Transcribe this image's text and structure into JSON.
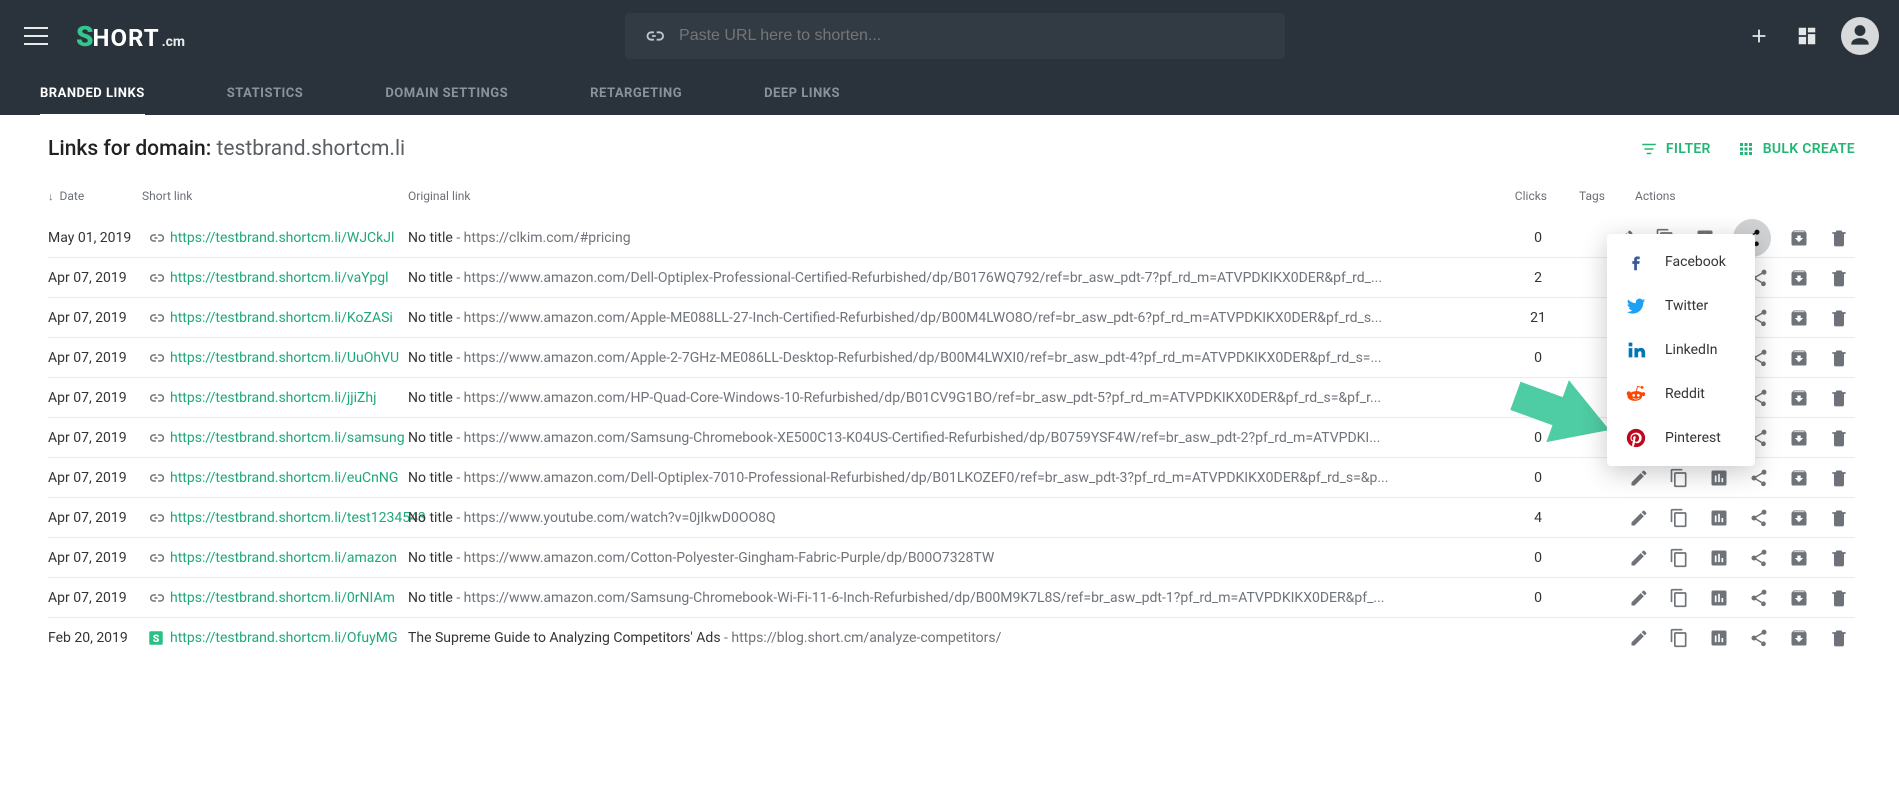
{
  "header": {
    "search_placeholder": "Paste URL here to shorten..."
  },
  "nav": [
    "BRANDED LINKS",
    "STATISTICS",
    "DOMAIN SETTINGS",
    "RETARGETING",
    "DEEP LINKS"
  ],
  "page": {
    "title_prefix": "Links for domain: ",
    "domain": "testbrand.shortcm.li",
    "filter_label": "FILTER",
    "bulk_label": "BULK CREATE"
  },
  "columns": {
    "date": "Date",
    "short": "Short link",
    "orig": "Original link",
    "clicks": "Clicks",
    "tags": "Tags",
    "actions": "Actions"
  },
  "share_menu": [
    "Facebook",
    "Twitter",
    "LinkedIn",
    "Reddit",
    "Pinterest"
  ],
  "rows": [
    {
      "date": "May 01, 2019",
      "short": "https://testbrand.shortcm.li/WJCkJl",
      "title": "No title",
      "orig": "https://clkim.com/#pricing",
      "clicks": "0"
    },
    {
      "date": "Apr 07, 2019",
      "short": "https://testbrand.shortcm.li/vaYpgl",
      "title": "No title",
      "orig": "https://www.amazon.com/Dell-Optiplex-Professional-Certified-Refurbished/dp/B0176WQ792/ref=br_asw_pdt-7?pf_rd_m=ATVPDKIKX0DER&pf_rd_...",
      "clicks": "2"
    },
    {
      "date": "Apr 07, 2019",
      "short": "https://testbrand.shortcm.li/KoZASi",
      "title": "No title",
      "orig": "https://www.amazon.com/Apple-ME088LL-27-Inch-Certified-Refurbished/dp/B00M4LWO8O/ref=br_asw_pdt-6?pf_rd_m=ATVPDKIKX0DER&pf_rd_s...",
      "clicks": "21"
    },
    {
      "date": "Apr 07, 2019",
      "short": "https://testbrand.shortcm.li/UuOhVU",
      "title": "No title",
      "orig": "https://www.amazon.com/Apple-2-7GHz-ME086LL-Desktop-Refurbished/dp/B00M4LWXI0/ref=br_asw_pdt-4?pf_rd_m=ATVPDKIKX0DER&pf_rd_s=...",
      "clicks": "0"
    },
    {
      "date": "Apr 07, 2019",
      "short": "https://testbrand.shortcm.li/jjiZhj",
      "title": "No title",
      "orig": "https://www.amazon.com/HP-Quad-Core-Windows-10-Refurbished/dp/B01CV9G1BO/ref=br_asw_pdt-5?pf_rd_m=ATVPDKIKX0DER&pf_rd_s=&pf_r...",
      "clicks": "0"
    },
    {
      "date": "Apr 07, 2019",
      "short": "https://testbrand.shortcm.li/samsung",
      "title": "No title",
      "orig": "https://www.amazon.com/Samsung-Chromebook-XE500C13-K04US-Certified-Refurbished/dp/B0759YSF4W/ref=br_asw_pdt-2?pf_rd_m=ATVPDKI...",
      "clicks": "0"
    },
    {
      "date": "Apr 07, 2019",
      "short": "https://testbrand.shortcm.li/euCnNG",
      "title": "No title",
      "orig": "https://www.amazon.com/Dell-Optiplex-7010-Professional-Refurbished/dp/B01LKOZEF0/ref=br_asw_pdt-3?pf_rd_m=ATVPDKIKX0DER&pf_rd_s=&p...",
      "clicks": "0"
    },
    {
      "date": "Apr 07, 2019",
      "short": "https://testbrand.shortcm.li/test1234543",
      "title": "No title",
      "orig": "https://www.youtube.com/watch?v=0jIkwD0OO8Q",
      "clicks": "4"
    },
    {
      "date": "Apr 07, 2019",
      "short": "https://testbrand.shortcm.li/amazon",
      "title": "No title",
      "orig": "https://www.amazon.com/Cotton-Polyester-Gingham-Fabric-Purple/dp/B00O7328TW",
      "clicks": "0"
    },
    {
      "date": "Apr 07, 2019",
      "short": "https://testbrand.shortcm.li/0rNIAm",
      "title": "No title",
      "orig": "https://www.amazon.com/Samsung-Chromebook-Wi-Fi-11-6-Inch-Refurbished/dp/B00M9K7L8S/ref=br_asw_pdt-1?pf_rd_m=ATVPDKIKX0DER&pf_...",
      "clicks": "0"
    },
    {
      "date": "Feb 20, 2019",
      "short": "https://testbrand.shortcm.li/OfuyMG",
      "title": "The Supreme Guide to Analyzing Competitors' Ads",
      "orig": "https://blog.short.cm/analyze-competitors/",
      "clicks": "",
      "brand": true,
      "noborder": true
    }
  ]
}
